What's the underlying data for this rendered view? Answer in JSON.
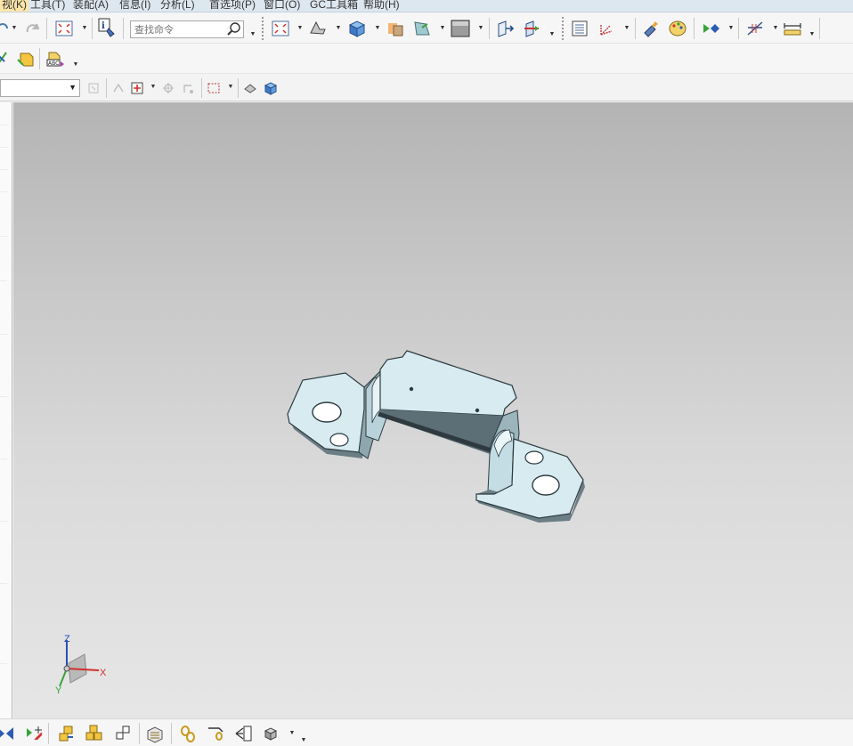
{
  "menubar": {
    "items": [
      {
        "label": "视(K)",
        "active": true
      },
      {
        "label": "工具(T)",
        "active": false
      },
      {
        "label": "装配(A)",
        "active": false
      },
      {
        "label": "信息(I)",
        "active": false
      },
      {
        "label": "分析(L)",
        "active": false
      },
      {
        "label": "首选项(P)",
        "active": false
      },
      {
        "label": "窗口(O)",
        "active": false
      },
      {
        "label": "GC工具箱",
        "active": false
      },
      {
        "label": "帮助(H)",
        "active": false
      }
    ]
  },
  "toolbar_top": {
    "search_placeholder": "查找命令",
    "icons": [
      "redo-icon",
      "fit-view-icon",
      "info-icon",
      "search-icon",
      "fit-icon",
      "orient-view-icon",
      "shaded-cube-icon",
      "edit-section-icon",
      "face-analysis-icon",
      "background-color-icon",
      "wcs-move-icon",
      "wcs-icon",
      "layer-settings-icon",
      "wcs-orient-icon",
      "paint-icon",
      "palette-icon",
      "snap-view-icon",
      "measure-angle-icon",
      "measure-distance-icon"
    ]
  },
  "toolbar_second": {
    "icons": [
      "extrude-icon",
      "material-icon",
      "text-abc-icon"
    ]
  },
  "selection_bar": {
    "filter_value": "",
    "icons": [
      "select-all-icon",
      "snap-point-icon",
      "snap-end-icon",
      "snap-mid-icon",
      "rectangle-select-icon",
      "show-hide-icon",
      "view-cube-icon"
    ]
  },
  "statusbar": {
    "icons": [
      "assembly-constraint-icon",
      "move-component-icon",
      "add-component-icon",
      "component-array-icon",
      "mirror-assembly-icon",
      "wave-geometry-icon",
      "link-icon",
      "reference-set-icon",
      "assembly-navigator-icon",
      "explode-view-icon"
    ]
  },
  "triad": {
    "x_label": "X",
    "y_label": "Y",
    "z_label": "Z"
  },
  "colors": {
    "part_face": "#d4e8ee",
    "part_edge": "#2e3a40",
    "part_side": "#7f9aa3",
    "viewport_top": "#b4b4b4",
    "viewport_bottom": "#e6e6e6",
    "active_menu": "#fbe6a8"
  }
}
